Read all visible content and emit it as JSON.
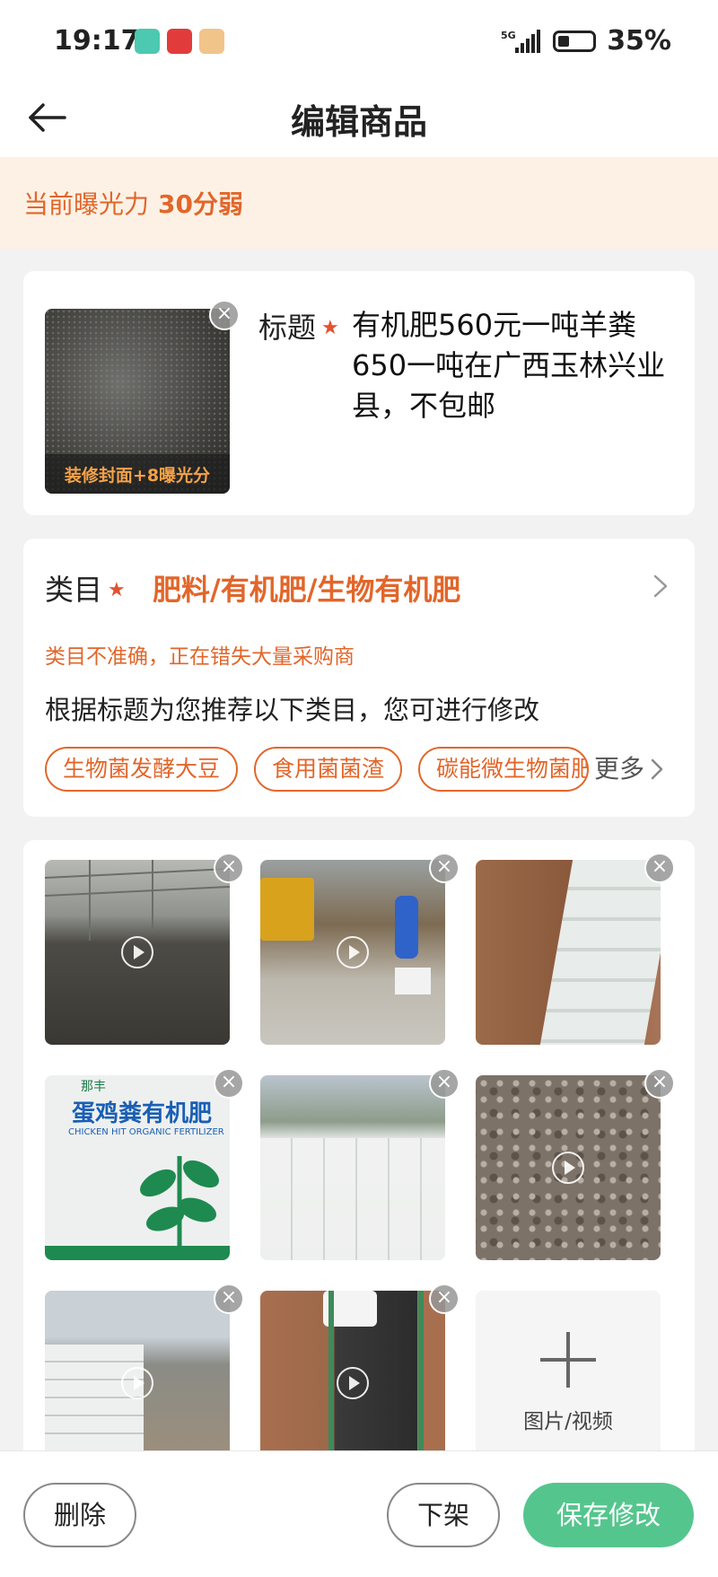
{
  "status": {
    "time": "19:17",
    "network": "5G",
    "battery": "35%"
  },
  "header": {
    "title": "编辑商品"
  },
  "exposure": {
    "label": "当前曝光力",
    "value": "30分弱"
  },
  "product": {
    "cover_label": "装修封面+8曝光分",
    "title_label": "标题",
    "title_text": "有机肥560元一吨羊粪650一吨在广西玉林兴业县，不包邮"
  },
  "category": {
    "label": "类目",
    "value": "肥料/有机肥/生物有机肥",
    "warning": "类目不准确，正在错失大量采购商",
    "hint": "根据标题为您推荐以下类目，您可进行修改",
    "suggestions": [
      "生物菌发酵大豆",
      "食用菌菌渣",
      "碳能微生物菌肥"
    ],
    "more_label": "更多"
  },
  "media": {
    "items": [
      {
        "kind": "video",
        "desc": "soil-pile-shed"
      },
      {
        "kind": "video",
        "desc": "worker-loading"
      },
      {
        "kind": "image",
        "desc": "sack-row-field"
      },
      {
        "kind": "image",
        "desc": "fertilizer-bag-closeup"
      },
      {
        "kind": "image",
        "desc": "sack-stack-outdoor"
      },
      {
        "kind": "video",
        "desc": "granular-closeup"
      },
      {
        "kind": "video",
        "desc": "sacks-by-road"
      },
      {
        "kind": "video",
        "desc": "conveyor-belt"
      }
    ],
    "bag_text_main": "蛋鸡粪有机肥",
    "bag_text_sub": "CHICKEN HIT ORGANIC FERTILIZER",
    "bag_text_top": "那丰",
    "add_label": "图片/视频"
  },
  "actions": {
    "delete": "删除",
    "unlist": "下架",
    "save": "保存修改"
  },
  "colors": {
    "accent": "#e2662a",
    "primary": "#55c58e",
    "banner_bg": "#fdf1e5"
  }
}
